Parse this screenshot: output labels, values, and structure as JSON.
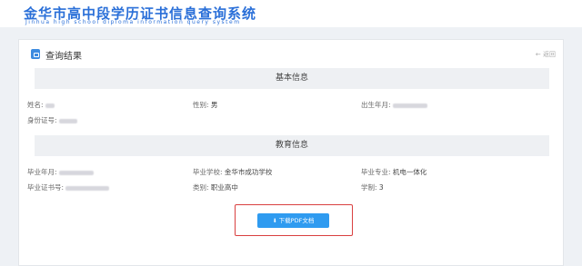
{
  "site": {
    "title": "金华市高中段学历证书信息查询系统",
    "subtitle": "Jinhua high school diploma information query system"
  },
  "panel": {
    "title": "查询结果",
    "back_label": "← 返回"
  },
  "basic": {
    "section_title": "基本信息",
    "name_label": "姓名:",
    "gender_label": "性别:",
    "gender_value": "男",
    "birth_label": "出生年月:",
    "id_label": "身份证号:"
  },
  "education": {
    "section_title": "教育信息",
    "grad_date_label": "毕业年月:",
    "school_label": "毕业学校:",
    "school_value": "金华市成功学校",
    "major_label": "毕业专业:",
    "major_value": "机电一体化",
    "cert_no_label": "毕业证书号:",
    "category_label": "类别:",
    "category_value": "职业高中",
    "duration_label": "学制:",
    "duration_value": "3"
  },
  "download": {
    "label": "下载PDF文档",
    "icon": "download-icon"
  },
  "colors": {
    "brand": "#2a6fd8",
    "button": "#2f9bf0",
    "highlight_border": "#d94040"
  }
}
